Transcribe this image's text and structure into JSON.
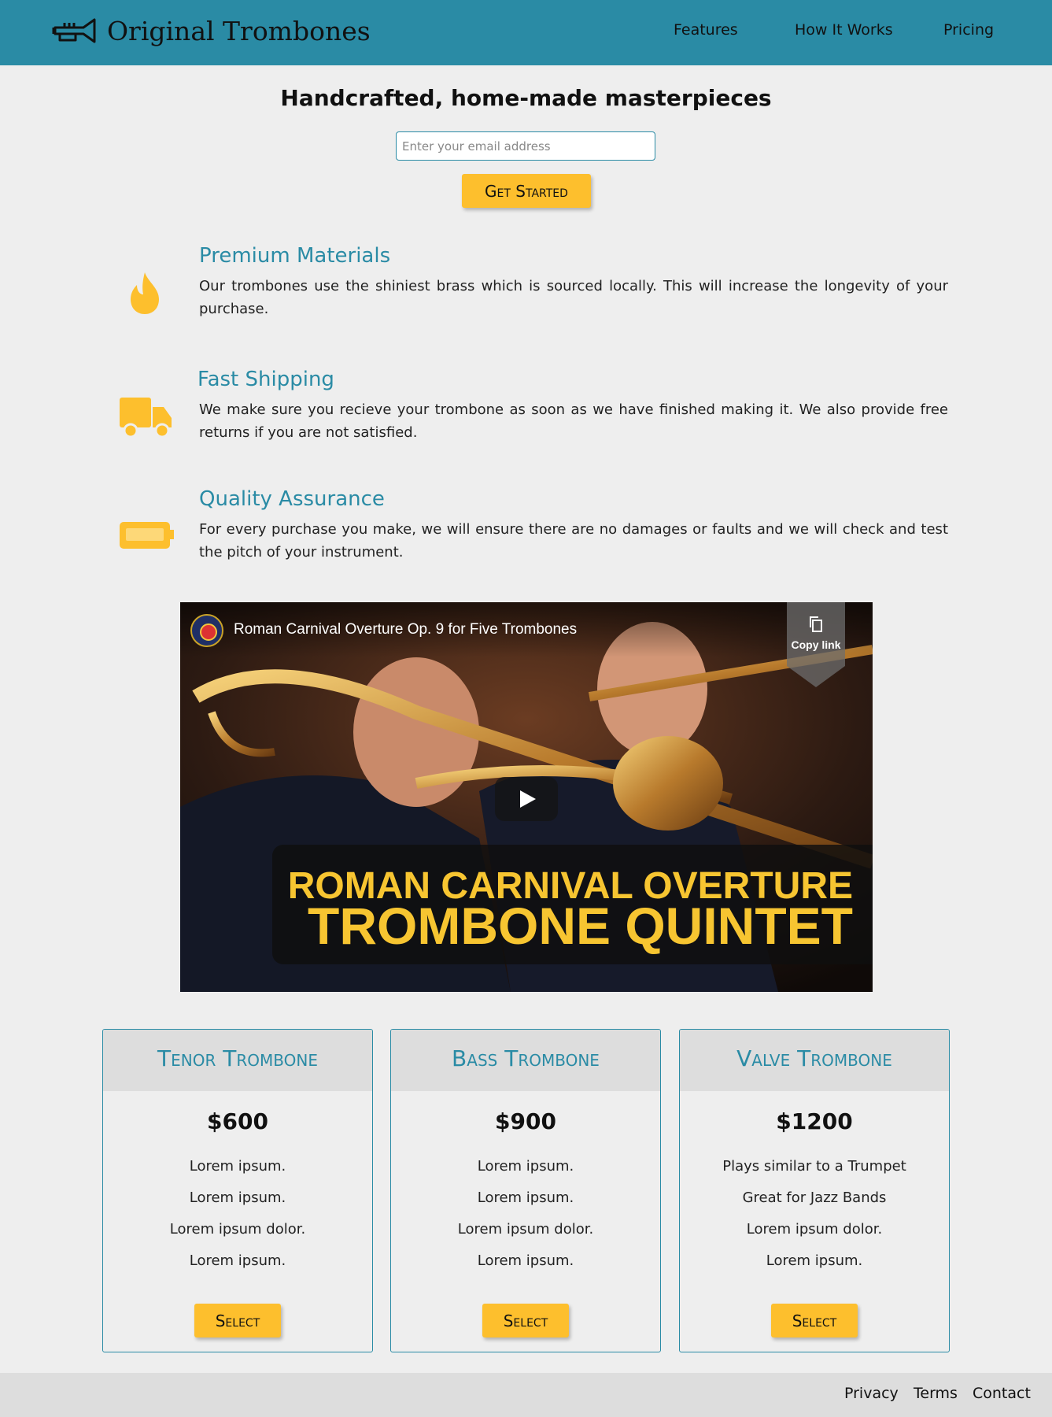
{
  "brand": {
    "name": "Original Trombones",
    "icon": "trumpet-logo-icon"
  },
  "nav": [
    {
      "label": "Features"
    },
    {
      "label": "How It Works"
    },
    {
      "label": "Pricing"
    }
  ],
  "hero": {
    "title": "Handcrafted, home-made masterpieces",
    "email_placeholder": "Enter your email address",
    "cta_label": "Get Started"
  },
  "features": [
    {
      "title": "Premium Materials",
      "text": "Our trombones use the shiniest brass which is sourced locally. This will increase the longevity of your purchase.",
      "icon": "fire-icon"
    },
    {
      "title": "Fast Shipping",
      "text": "We make sure you recieve your trombone as soon as we have finished making it. We also provide free returns if you are not satisfied.",
      "icon": "truck-icon"
    },
    {
      "title": "Quality Assurance",
      "text": "For every purchase you make, we will ensure there are no damages or faults and we will check and test the pitch of your instrument.",
      "icon": "battery-icon"
    }
  ],
  "video": {
    "title": "Roman Carnival Overture Op. 9 for Five Trombones",
    "copy_link": "Copy link",
    "banner_line1": "ROMAN CARNIVAL OVERTURE",
    "banner_line2": "TROMBONE QUINTET"
  },
  "pricing": [
    {
      "title": "Tenor Trombone",
      "price": "$600",
      "features": [
        "Lorem ipsum.",
        "Lorem ipsum.",
        "Lorem ipsum dolor.",
        "Lorem ipsum."
      ],
      "select_label": "Select"
    },
    {
      "title": "Bass Trombone",
      "price": "$900",
      "features": [
        "Lorem ipsum.",
        "Lorem ipsum.",
        "Lorem ipsum dolor.",
        "Lorem ipsum."
      ],
      "select_label": "Select"
    },
    {
      "title": "Valve Trombone",
      "price": "$1200",
      "features": [
        "Plays similar to a Trumpet",
        "Great for Jazz Bands",
        "Lorem ipsum dolor.",
        "Lorem ipsum."
      ],
      "select_label": "Select"
    }
  ],
  "footer": [
    {
      "label": "Privacy"
    },
    {
      "label": "Terms"
    },
    {
      "label": "Contact"
    }
  ],
  "colors": {
    "header": "#2a8ba5",
    "accent": "#fdbf2d",
    "background": "#eeeeee",
    "panel": "#dddddd"
  }
}
